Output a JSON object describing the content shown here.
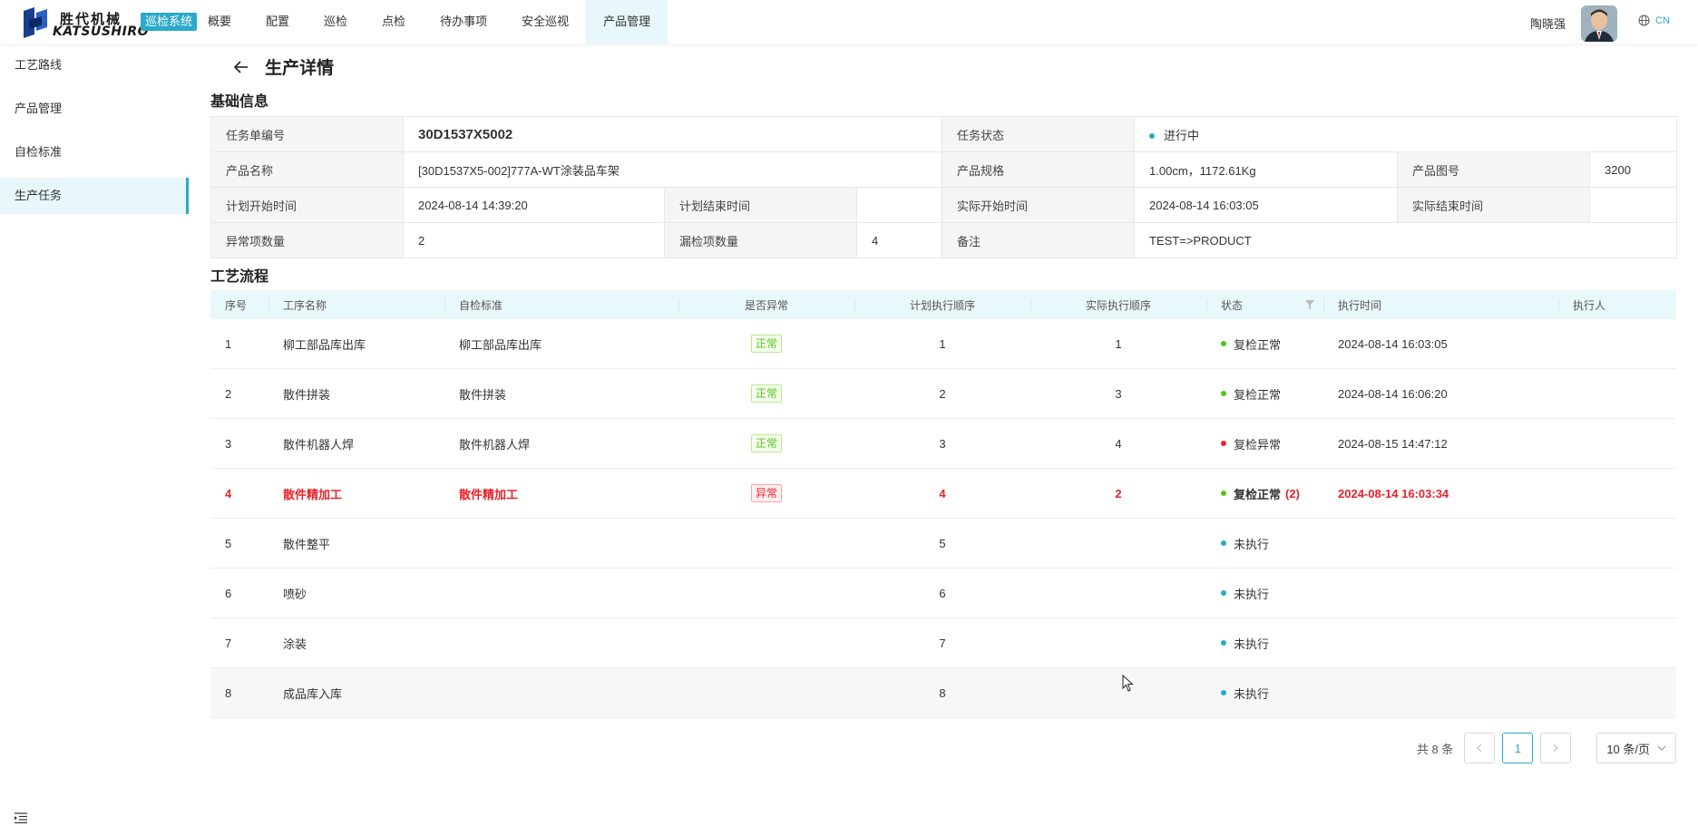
{
  "header": {
    "logo_cn": "胜代机械",
    "logo_en": "KATSUSHIRO",
    "system_badge": "巡检系统",
    "nav": [
      "概要",
      "配置",
      "巡检",
      "点检",
      "待办事项",
      "安全巡视",
      "产品管理"
    ],
    "active_nav_index": 6,
    "user_name": "陶晓强",
    "lang": "CN"
  },
  "sidebar": {
    "items": [
      "工艺路线",
      "产品管理",
      "自检标准",
      "生产任务"
    ],
    "active_index": 3
  },
  "page": {
    "title": "生产详情",
    "section_basic": "基础信息",
    "section_process": "工艺流程"
  },
  "basic": {
    "task_no_label": "任务单编号",
    "task_no": "30D1537X5002",
    "task_status_label": "任务状态",
    "task_status": "进行中",
    "product_name_label": "产品名称",
    "product_name": "[30D1537X5-002]777A-WT涂装品车架",
    "product_spec_label": "产品规格",
    "product_spec": "1.00cm，1172.61Kg",
    "drawing_no_label": "产品图号",
    "drawing_no": "3200",
    "plan_start_label": "计划开始时间",
    "plan_start": "2024-08-14 14:39:20",
    "plan_end_label": "计划结束时间",
    "plan_end": "",
    "actual_start_label": "实际开始时间",
    "actual_start": "2024-08-14 16:03:05",
    "actual_end_label": "实际结束时间",
    "actual_end": "",
    "abnormal_count_label": "异常项数量",
    "abnormal_count": "2",
    "missed_count_label": "漏检项数量",
    "missed_count": "4",
    "remark_label": "备注",
    "remark": "TEST=>PRODUCT"
  },
  "process": {
    "columns": [
      "序号",
      "工序名称",
      "自检标准",
      "是否异常",
      "计划执行顺序",
      "实际执行顺序",
      "状态",
      "执行时间",
      "执行人"
    ],
    "rows": [
      {
        "no": "1",
        "name": "柳工部品库出库",
        "standard": "柳工部品库出库",
        "abnormal": "正常",
        "plan_order": "1",
        "actual_order": "1",
        "status": "复检正常",
        "status_count": "",
        "time": "2024-08-14 16:03:05",
        "operator": ""
      },
      {
        "no": "2",
        "name": "散件拼装",
        "standard": "散件拼装",
        "abnormal": "正常",
        "plan_order": "2",
        "actual_order": "3",
        "status": "复检正常",
        "status_count": "",
        "time": "2024-08-14 16:06:20",
        "operator": ""
      },
      {
        "no": "3",
        "name": "散件机器人焊",
        "standard": "散件机器人焊",
        "abnormal": "正常",
        "plan_order": "3",
        "actual_order": "4",
        "status": "复检异常",
        "status_count": "",
        "time": "2024-08-15 14:47:12",
        "operator": ""
      },
      {
        "no": "4",
        "name": "散件精加工",
        "standard": "散件精加工",
        "abnormal": "异常",
        "plan_order": "4",
        "actual_order": "2",
        "status": "复检正常",
        "status_count": "(2)",
        "time": "2024-08-14 16:03:34",
        "operator": ""
      },
      {
        "no": "5",
        "name": "散件整平",
        "standard": "",
        "abnormal": "",
        "plan_order": "5",
        "actual_order": "",
        "status": "未执行",
        "status_count": "",
        "time": "",
        "operator": ""
      },
      {
        "no": "6",
        "name": "喷砂",
        "standard": "",
        "abnormal": "",
        "plan_order": "6",
        "actual_order": "",
        "status": "未执行",
        "status_count": "",
        "time": "",
        "operator": ""
      },
      {
        "no": "7",
        "name": "涂装",
        "standard": "",
        "abnormal": "",
        "plan_order": "7",
        "actual_order": "",
        "status": "未执行",
        "status_count": "",
        "time": "",
        "operator": ""
      },
      {
        "no": "8",
        "name": "成品库入库",
        "standard": "",
        "abnormal": "",
        "plan_order": "8",
        "actual_order": "",
        "status": "未执行",
        "status_count": "",
        "time": "",
        "operator": ""
      }
    ]
  },
  "pagination": {
    "total": "共 8 条",
    "current_page": "1",
    "page_size": "10 条/页"
  },
  "colors": {
    "accent": "#2aa9c9",
    "ok": "#52c41a",
    "error": "#f5222d",
    "pending": "#2aa9c9"
  }
}
